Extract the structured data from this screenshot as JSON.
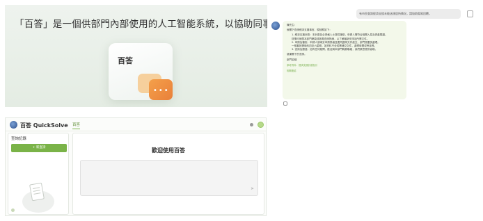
{
  "hero": {
    "headline": "「百答」是一個供部門內部使用的人工智能系統，以協助同事回覆書面公眾查詢。",
    "card_title": "百答",
    "bubble_dots": "•••"
  },
  "chat": {
    "user_message": "有市民查詢經濟支援未能送達居所情況，請協助擬寫回覆。",
    "bot_greeting": "陳先生：",
    "bot_intro": "就閣下查詢經濟支援事宜，現回覆如下：",
    "bot_points": [
      "1. 經濟支援計劃：本計劃為合資格人士提供援助，申請人需符合相關入息及資產限額。",
      "   詳情可參閱本部門網頁或致電查詢熱線，以了解最新安排及所需文件。",
      "2. 申請及審批：申請人須填妥申請表格並連同證明文件遞交，部門會盡快處理。",
      "   一般審批需時約四至六星期，如資料不全或需補交文件，處理時間或會延長。",
      "3. 查詢及跟進：如有任何疑問，歡迎與本部門職員聯絡，我們樂意提供協助。"
    ],
    "bot_closing": "感謝閣下的查詢。",
    "bot_signoff": "部門名稱",
    "bot_link_1": "參考資料：經濟支援計劃指引",
    "bot_link_2": "相關連結"
  },
  "app": {
    "title": "百答 QuickSolve",
    "tab_label": "百答",
    "sidebar": {
      "history_label": "查詢記錄",
      "new_query_label": "+ 新查詢"
    },
    "main": {
      "welcome": "歡迎使用百答",
      "send_glyph": "➤"
    }
  },
  "colors": {
    "accent_green": "#7ab348",
    "bot_bubble": "#f3f8ea",
    "orange_bubble": "#e9803a"
  }
}
